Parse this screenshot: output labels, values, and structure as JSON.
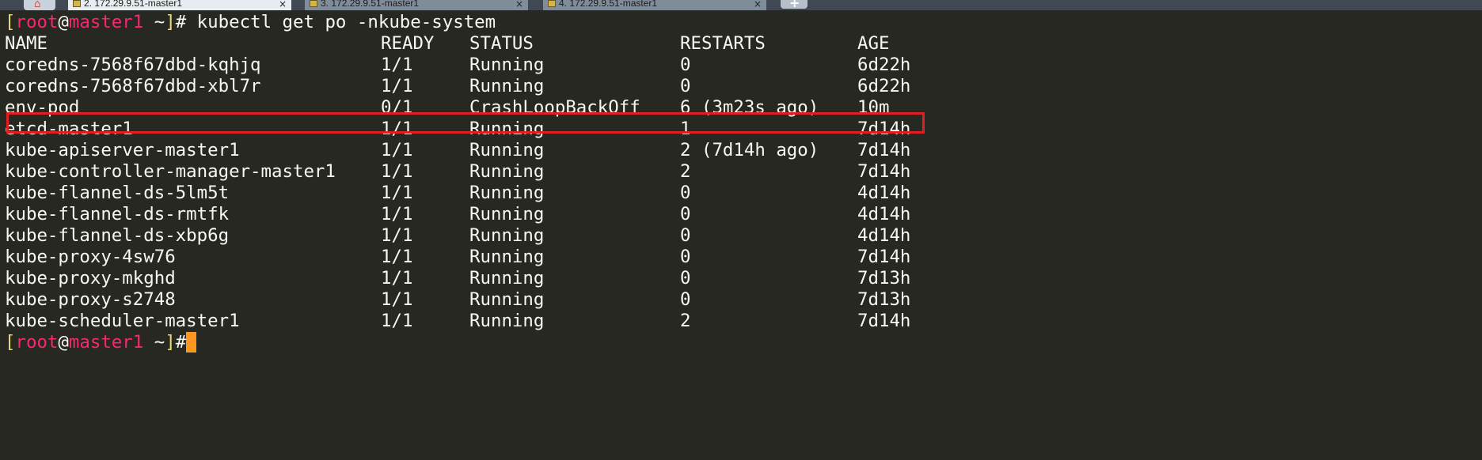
{
  "tabs": [
    {
      "label": "2. 172.29.9.51-master1",
      "close": "×",
      "active": true
    },
    {
      "label": "3. 172.29.9.51-master1",
      "close": "×",
      "active": false
    },
    {
      "label": "4. 172.29.9.51-master1",
      "close": "×",
      "active": false
    }
  ],
  "tab_add_glyph": "+",
  "home_icon": "⌂",
  "prompt": {
    "open_bracket": "[",
    "user": "root",
    "at": "@",
    "host": "master1",
    "tilde": " ~",
    "close_bracket": "]",
    "hash": "#"
  },
  "command": " kubectl get po -nkube-system",
  "headers": {
    "name": "NAME",
    "ready": "READY",
    "status": "STATUS",
    "restarts": "RESTARTS",
    "age": "AGE"
  },
  "rows": [
    {
      "name": "coredns-7568f67dbd-kqhjq",
      "ready": "1/1",
      "status": "Running",
      "restarts": "0",
      "age": "6d22h"
    },
    {
      "name": "coredns-7568f67dbd-xbl7r",
      "ready": "1/1",
      "status": "Running",
      "restarts": "0",
      "age": "6d22h"
    },
    {
      "name": "env-pod",
      "ready": "0/1",
      "status": "CrashLoopBackOff",
      "restarts": "6 (3m23s ago)",
      "age": "10m"
    },
    {
      "name": "etcd-master1",
      "ready": "1/1",
      "status": "Running",
      "restarts": "1",
      "age": "7d14h"
    },
    {
      "name": "kube-apiserver-master1",
      "ready": "1/1",
      "status": "Running",
      "restarts": "2 (7d14h ago)",
      "age": "7d14h"
    },
    {
      "name": "kube-controller-manager-master1",
      "ready": "1/1",
      "status": "Running",
      "restarts": "2",
      "age": "7d14h"
    },
    {
      "name": "kube-flannel-ds-5lm5t",
      "ready": "1/1",
      "status": "Running",
      "restarts": "0",
      "age": "4d14h"
    },
    {
      "name": "kube-flannel-ds-rmtfk",
      "ready": "1/1",
      "status": "Running",
      "restarts": "0",
      "age": "4d14h"
    },
    {
      "name": "kube-flannel-ds-xbp6g",
      "ready": "1/1",
      "status": "Running",
      "restarts": "0",
      "age": "4d14h"
    },
    {
      "name": "kube-proxy-4sw76",
      "ready": "1/1",
      "status": "Running",
      "restarts": "0",
      "age": "7d14h"
    },
    {
      "name": "kube-proxy-mkghd",
      "ready": "1/1",
      "status": "Running",
      "restarts": "0",
      "age": "7d13h"
    },
    {
      "name": "kube-proxy-s2748",
      "ready": "1/1",
      "status": "Running",
      "restarts": "0",
      "age": "7d13h"
    },
    {
      "name": "kube-scheduler-master1",
      "ready": "1/1",
      "status": "Running",
      "restarts": "2",
      "age": "7d14h"
    }
  ],
  "colors": {
    "background": "#272822",
    "foreground": "#f8f8f2",
    "prompt_bracket": "#e6db74",
    "prompt_user_host": "#f92672",
    "cursor": "#fd971f",
    "highlight_box": "#e02020"
  }
}
